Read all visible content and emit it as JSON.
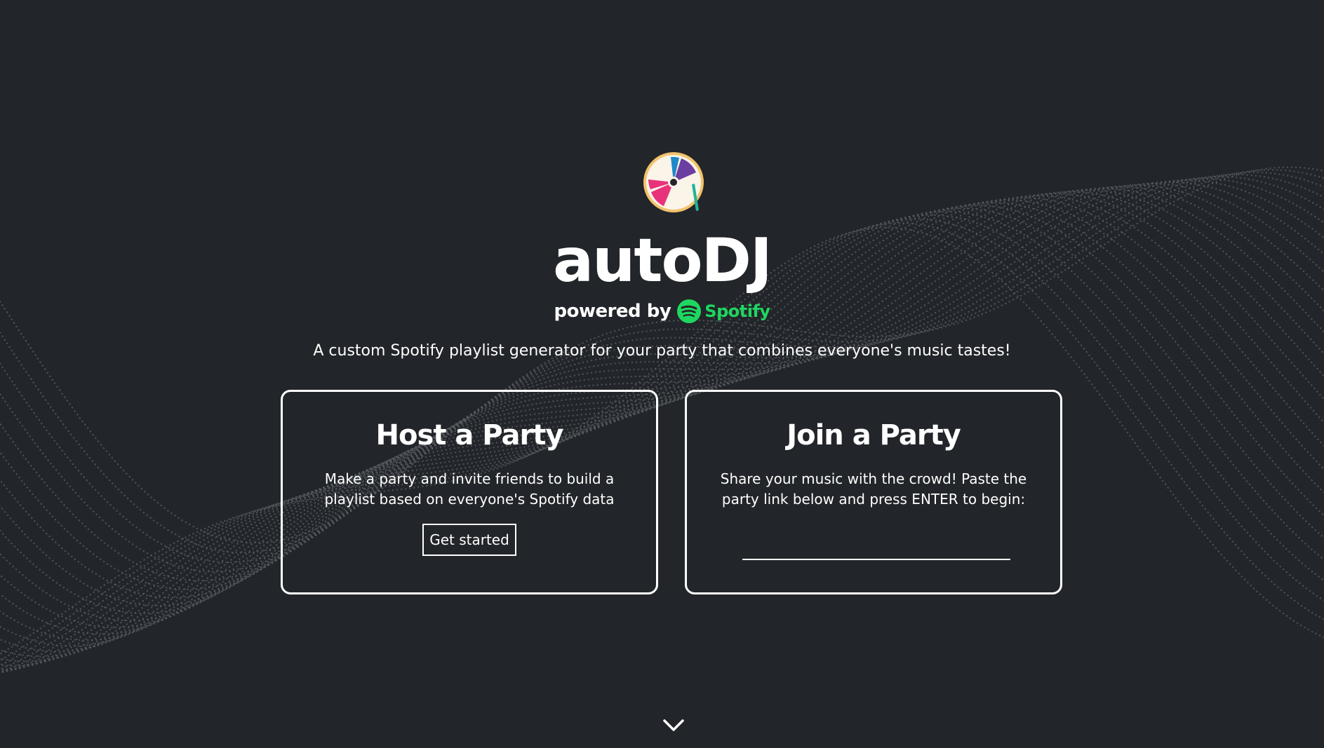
{
  "app": {
    "title": "autoDJ",
    "powered_by": "powered by",
    "spotify_wordmark": "Spotify",
    "tagline": "A custom Spotify playlist generator for your party that combines everyone's music tastes!"
  },
  "host_card": {
    "title": "Host a Party",
    "description": "Make a party and invite friends to build a playlist based on everyone's Spotify data",
    "button_label": "Get started"
  },
  "join_card": {
    "title": "Join a Party",
    "description": "Share your music with the crowd! Paste the party link below and press ENTER to begin:",
    "input_value": "",
    "input_placeholder": ""
  },
  "icons": {
    "logo": "vinyl-disc-logo-icon",
    "spotify": "spotify-icon",
    "scroll": "chevron-down-icon"
  },
  "colors": {
    "background": "#222529",
    "text": "#ffffff",
    "spotify_green": "#1ed760",
    "wave_dots": "#5a5d62"
  }
}
